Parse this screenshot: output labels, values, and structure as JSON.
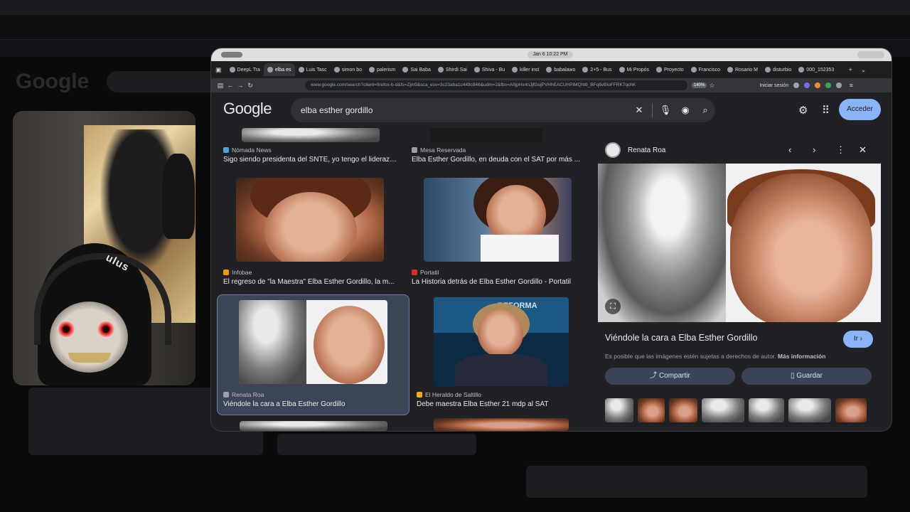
{
  "browser": {
    "clock": "Jan 6  10:22 PM",
    "tabs": [
      {
        "label": "DeepL Tra",
        "active": false
      },
      {
        "label": "elba es",
        "active": true
      },
      {
        "label": "Luis Tasc",
        "active": false
      },
      {
        "label": "simon bo",
        "active": false
      },
      {
        "label": "palerism",
        "active": false
      },
      {
        "label": "Sai Baba",
        "active": false
      },
      {
        "label": "Shirdi Sai",
        "active": false
      },
      {
        "label": "Shiva - Bu",
        "active": false
      },
      {
        "label": "killer inst",
        "active": false
      },
      {
        "label": "babalawo",
        "active": false
      },
      {
        "label": "2+5 - Bus",
        "active": false
      },
      {
        "label": "Mi Propós",
        "active": false
      },
      {
        "label": "Proyecto",
        "active": false
      },
      {
        "label": "Francisco",
        "active": false
      },
      {
        "label": "Rosario M",
        "active": false
      },
      {
        "label": "disturbio",
        "active": false
      },
      {
        "label": "000_152353",
        "active": false
      }
    ],
    "url": "www.google.com/search?client=firefox-b-d&fs=Zjm9&sca_esv=3c23aba1c449c846&udm=2&fbs=AIIjpHx4nJjfGojPVHhEACUHPiMQht6_BFq6vBIoFFRK7qchK",
    "zoom": "140%",
    "signin": "Iniciar sesión"
  },
  "google": {
    "logo": "Google",
    "query": "elba esther gordillo",
    "signin_button": "Acceder"
  },
  "results": [
    {
      "source": "Nómada News",
      "caption": "Sigo siendo presidenta del SNTE, yo tengo el liderazgo..."
    },
    {
      "source": "Mesa Reservada",
      "caption": "Elba Esther Gordillo, en deuda con el SAT por más ..."
    },
    {
      "source": "Infobae",
      "caption": "El regreso de \"la Maestra\" Elba Esther Gordillo, la m..."
    },
    {
      "source": "Portatil",
      "caption": "La Historia detrás de Elba Esther Gordillo - Portatil"
    },
    {
      "source": "Renata Roa",
      "caption": "Viéndole la cara a Elba Esther Gordillo"
    },
    {
      "source": "El Heraldo de Saltillo",
      "caption": "Debe maestra Elba Esther 21 mdp al SAT"
    }
  ],
  "news_banner": "REFORMA",
  "detail": {
    "source": "Renata Roa",
    "title": "Viéndole la cara a Elba Esther Gordillo",
    "go_button": "Ir",
    "note": "Es posible que las imágenes estén sujetas a derechos de autor.",
    "note_link": "Más información",
    "share_button": "Compartir",
    "save_button": "Guardar"
  },
  "webcam": {
    "hoodie_text": "ulus"
  },
  "colors": {
    "accent": "#8ab4f8",
    "panel": "#202124",
    "selected": "#3c4458"
  }
}
